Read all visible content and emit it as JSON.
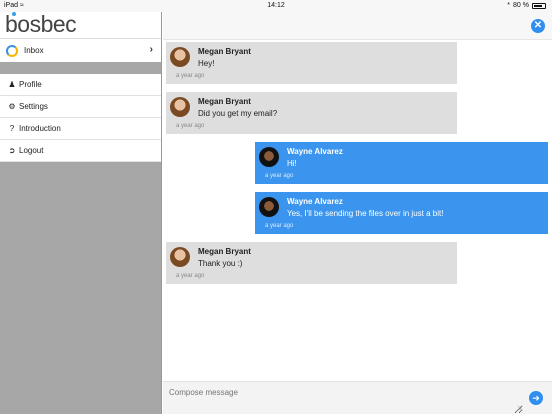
{
  "status": {
    "device": "iPad",
    "time": "14:12",
    "battery": "80 %",
    "battery_level": 0.8
  },
  "sidebar": {
    "logo": "bosbec",
    "inbox": {
      "label": "Inbox"
    },
    "items": [
      {
        "label": "Profile",
        "icon": "user-icon"
      },
      {
        "label": "Settings",
        "icon": "gear-icon"
      },
      {
        "label": "Introduction",
        "icon": "question-icon"
      },
      {
        "label": "Logout",
        "icon": "logout-icon"
      }
    ]
  },
  "conversation": {
    "messages": [
      {
        "direction": "in",
        "sender": "Megan Bryant",
        "text": "Hey!",
        "time": "a year ago"
      },
      {
        "direction": "in",
        "sender": "Megan Bryant",
        "text": "Did you get my email?",
        "time": "a year ago"
      },
      {
        "direction": "out",
        "sender": "Wayne Alvarez",
        "text": "Hi!",
        "time": "a year ago"
      },
      {
        "direction": "out",
        "sender": "Wayne Alvarez",
        "text": "Yes, I'll be sending the files over in just a bit!",
        "time": "a year ago"
      },
      {
        "direction": "in",
        "sender": "Megan Bryant",
        "text": "Thank you :)",
        "time": "a year ago"
      }
    ]
  },
  "compose": {
    "placeholder": "Compose message"
  },
  "colors": {
    "accent": "#2f8ef0",
    "outgoing_bubble": "#3b95ee",
    "incoming_bubble": "#dedede"
  }
}
